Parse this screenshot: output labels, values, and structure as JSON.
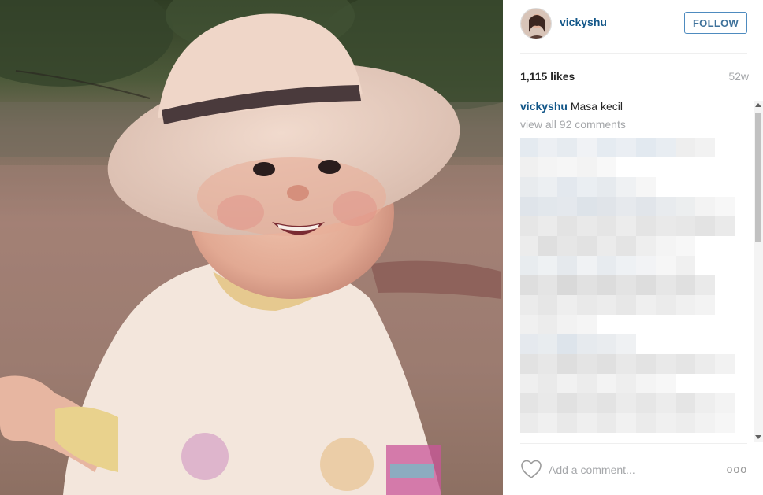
{
  "post": {
    "username": "vickyshu",
    "follow_label": "FOLLOW",
    "likes": "1,115 likes",
    "age": "52w",
    "caption_user": "vickyshu",
    "caption_text": "Masa kecil",
    "view_all": "view all 92 comments",
    "comment_placeholder": "Add a comment...",
    "more_label": "ooo"
  },
  "colors": {
    "link_blue": "#125688",
    "follow_border": "#4e8bbf",
    "muted_gray": "#a5a7aa"
  },
  "icons": {
    "heart": "heart-icon",
    "more": "more-options-icon"
  }
}
